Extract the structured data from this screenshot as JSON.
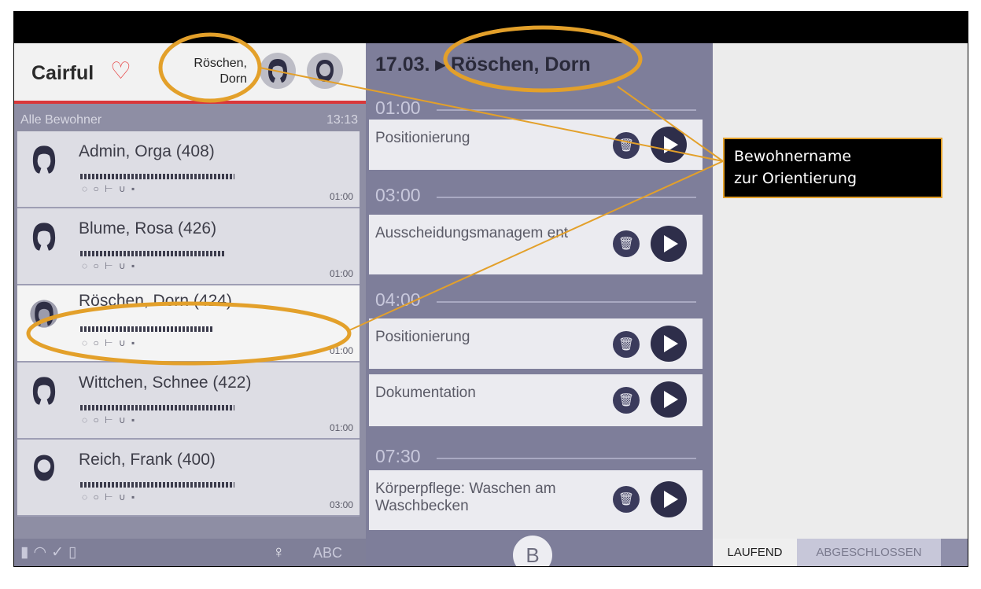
{
  "app": {
    "logo_text": "Cairful",
    "header_name": "Röschen,\nDorn",
    "accent_red": "#d9383a",
    "panel_color": "#8e8ea4"
  },
  "resident_list": {
    "title": "Alle Bewohner",
    "clock": "13:13",
    "residents": [
      {
        "name": "Admin, Orga (408)",
        "time": "01:00",
        "progress": 0.66,
        "avatar": "female-avatar-icon"
      },
      {
        "name": "Blume, Rosa (426)",
        "time": "01:00",
        "progress": 0.62,
        "avatar": "female-avatar-icon"
      },
      {
        "name": "Röschen, Dorn (424)",
        "time": "01:00",
        "progress": 0.6,
        "avatar": "female-avatar-icon"
      },
      {
        "name": "Wittchen, Schnee (422)",
        "time": "01:00",
        "progress": 0.66,
        "avatar": "female-avatar-icon"
      },
      {
        "name": "Reich, Frank (400)",
        "time": "03:00",
        "progress": 0.66,
        "avatar": "male-avatar-icon"
      }
    ],
    "status_icons_row": "◌ ○ ⊢ ∪ ▪"
  },
  "statusbar": {
    "abc_label": "ABC"
  },
  "schedule": {
    "title": "17.03. ▸ Röschen, Dorn",
    "groups": [
      {
        "time": "01:00",
        "tasks": [
          "Positionierung"
        ]
      },
      {
        "time": "03:00",
        "tasks": [
          "Ausscheidungsmanagem ent"
        ]
      },
      {
        "time": "04:00",
        "tasks": [
          "Positionierung",
          "Dokumentation"
        ]
      },
      {
        "time": "07:30",
        "tasks": [
          "Körperpflege: Waschen am Waschbecken"
        ]
      }
    ],
    "bottom_button_label": "B"
  },
  "tabs": {
    "active": "LAUFEND",
    "inactive": "ABGESCHLOSSEN"
  },
  "annotation": {
    "callout_line1": "Bewohnername",
    "callout_line2": "zur Orientierung",
    "highlight_color": "#e3a02a"
  }
}
